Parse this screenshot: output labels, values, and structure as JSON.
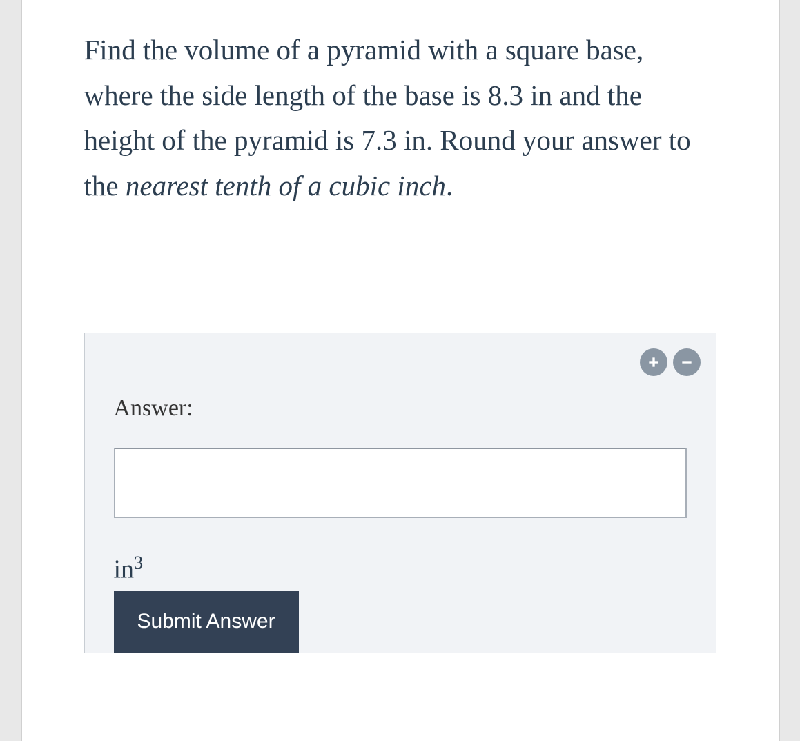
{
  "question": {
    "part1": "Find the volume of a pyramid with a square base, where the side length of the base is ",
    "side_length": "8.3 in",
    "part2": " and the height of the pyramid is ",
    "height": "7.3 in",
    "part3": ". Round your answer to the ",
    "italic_part": "nearest tenth of a cubic inch",
    "part4": "."
  },
  "answer_panel": {
    "label": "Answer:",
    "input_value": "",
    "unit_base": "in",
    "unit_exponent": "3",
    "submit_label": "Submit Answer"
  }
}
